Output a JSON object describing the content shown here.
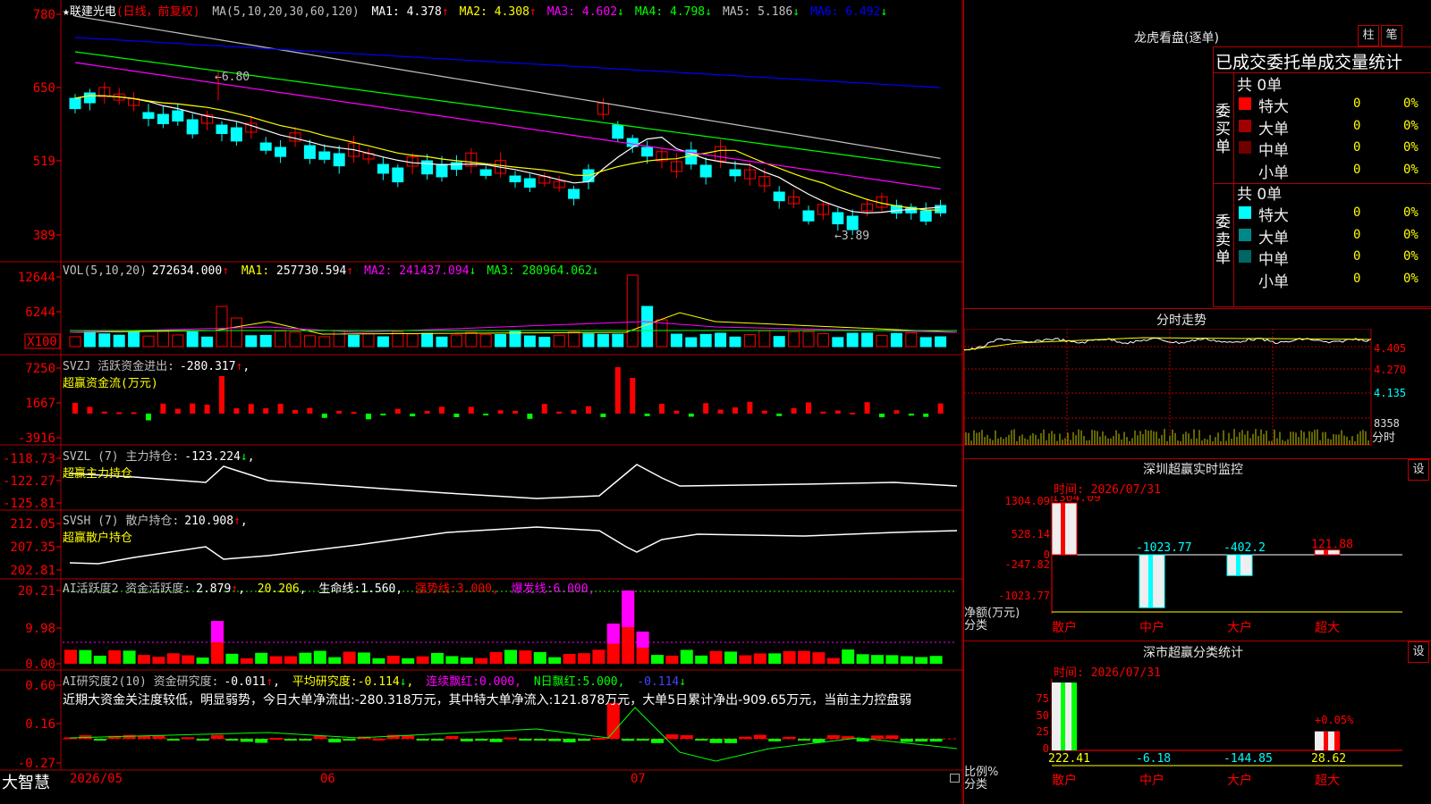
{
  "app_name": "大智慧",
  "stock": {
    "star": "★",
    "name": "联建光电",
    "period": "(日线，前复权)"
  },
  "price_panel": {
    "ma_label": "MA(5,10,20,30,60,120)",
    "ma": [
      {
        "label": "MA1:",
        "value": "4.378",
        "arrow": "↑",
        "color": "#ffffff"
      },
      {
        "label": "MA2:",
        "value": "4.308",
        "arrow": "↑",
        "color": "#ffff00"
      },
      {
        "label": "MA3:",
        "value": "4.602",
        "arrow": "↓",
        "color": "#ff00ff"
      },
      {
        "label": "MA4:",
        "value": "4.798",
        "arrow": "↓",
        "color": "#00ff00"
      },
      {
        "label": "MA5:",
        "value": "5.186",
        "arrow": "↓",
        "color": "#c0c0c0"
      },
      {
        "label": "MA6:",
        "value": "6.492",
        "arrow": "↓",
        "color": "#0000ff"
      }
    ],
    "y_ticks": [
      "780",
      "650",
      "519",
      "389"
    ],
    "high_mark": "6.80",
    "low_mark": "3.89"
  },
  "vol_panel": {
    "label": "VOL(5,10,20)",
    "value": "272634.000",
    "ma": [
      {
        "label": "MA1:",
        "value": "257730.594",
        "arrow": "↑",
        "color": "#ffff00"
      },
      {
        "label": "MA2:",
        "value": "241437.094",
        "arrow": "↓",
        "color": "#ff00ff"
      },
      {
        "label": "MA3:",
        "value": "280964.062",
        "arrow": "↓",
        "color": "#00ff00"
      }
    ],
    "y_ticks": [
      "12644",
      "6244"
    ],
    "unit": "X100"
  },
  "svzj_panel": {
    "label": "SVZJ  活跃资金进出:",
    "value": "-280.317",
    "arrow": "↑",
    "sub": "超赢资金流(万元)",
    "y_ticks": [
      "7250",
      "1667",
      "-3916"
    ]
  },
  "svzl_panel": {
    "label": "SVZL (7) 主力持仓:",
    "value": "-123.224",
    "arrow": "↓",
    "sub": "超赢主力持仓",
    "y_ticks": [
      "-118.73",
      "-122.27",
      "-125.81"
    ]
  },
  "svsh_panel": {
    "label": "SVSH (7) 散户持仓:",
    "value": "210.908",
    "arrow": "↑",
    "sub": "超赢散户持仓",
    "y_ticks": [
      "212.05",
      "207.35",
      "202.81"
    ]
  },
  "ai_active_panel": {
    "label": "AI活跃度2 资金活跃度:",
    "value": "2.879",
    "arrow": "↑",
    "v2": "20.206",
    "l3": "生命线:",
    "v3": "1.560",
    "l4": "强势线:",
    "v4": "3.000",
    "l5": "爆发线:",
    "v5": "6.000",
    "y_ticks": [
      "20.21",
      "9.98",
      "0.00"
    ]
  },
  "ai_research_panel": {
    "label": "AI研究度2(10) 资金研究度:",
    "value": "-0.011",
    "arrow": "↑",
    "l2": "平均研究度:",
    "v2": "-0.114",
    "a2": "↓",
    "l3": "连续飘红:",
    "v3": "0.000",
    "l4": "N日飘红:",
    "v4": "5.000",
    "v5": "-0.114",
    "a5": "↓",
    "comment": "近期大资金关注度较低，明显弱势，今日大单净流出:-280.318万元，其中特大单净流入:121.878万元，大单5日累计净出-909.65万元，当前主力控盘弱",
    "y_ticks": [
      "0.60",
      "0.16",
      "-0.27"
    ]
  },
  "x_axis": [
    "2026/05",
    "06",
    "07"
  ],
  "longhu": {
    "title": "龙虎看盘(逐单)",
    "btn_bar": "柱",
    "btn_pen": "笔",
    "header": "已成交委托单成交量统计",
    "buy": {
      "side": "委买单",
      "total": "共 0单",
      "rows": [
        {
          "name": "特大",
          "count": "0",
          "pct": "0%",
          "color": "#ff0000"
        },
        {
          "name": "大单",
          "count": "0",
          "pct": "0%",
          "color": "#a00000"
        },
        {
          "name": "中单",
          "count": "0",
          "pct": "0%",
          "color": "#700000"
        },
        {
          "name": "小单",
          "count": "0",
          "pct": "0%",
          "color": "#000000"
        }
      ]
    },
    "sell": {
      "side": "委卖单",
      "total": "共 0单",
      "rows": [
        {
          "name": "特大",
          "count": "0",
          "pct": "0%",
          "color": "#00ffff"
        },
        {
          "name": "大单",
          "count": "0",
          "pct": "0%",
          "color": "#008888"
        },
        {
          "name": "中单",
          "count": "0",
          "pct": "0%",
          "color": "#006666"
        },
        {
          "name": "小单",
          "count": "0",
          "pct": "0%",
          "color": "#000000"
        }
      ]
    }
  },
  "fenshi": {
    "title": "分时走势",
    "y_ticks": [
      "4.405",
      "4.270",
      "4.135"
    ],
    "vol_label": "8358",
    "x_label": "分时"
  },
  "monitor": {
    "title": "深圳超赢实时监控",
    "set": "设",
    "time": "时间: 2026/07/31",
    "y_ticks": [
      "1304.09",
      "528.14",
      "0",
      "-247.82",
      "-1023.77"
    ],
    "y_label": "净额(万元)",
    "x_label": "分类",
    "bars": [
      {
        "cat": "散户",
        "value": 1304.09,
        "label": "1304.09"
      },
      {
        "cat": "中户",
        "value": -1023.77,
        "label": "-1023.77"
      },
      {
        "cat": "大户",
        "value": -402.2,
        "label": "-402.2"
      },
      {
        "cat": "超大",
        "value": 121.88,
        "label": "121.88"
      }
    ]
  },
  "classify": {
    "title": "深市超赢分类统计",
    "set": "设",
    "time": "时间: 2026/07/31",
    "y_ticks": [
      "75",
      "50",
      "25",
      "0"
    ],
    "y_label": "比例%",
    "x_label": "分类",
    "bars": [
      {
        "cat": "散户",
        "value": 222.41,
        "pct": 100,
        "label": "222.41"
      },
      {
        "cat": "中户",
        "value": -6.18,
        "pct": 0,
        "label": "-6.18"
      },
      {
        "cat": "大户",
        "value": -144.85,
        "pct": 0,
        "label": "-144.85"
      },
      {
        "cat": "超大",
        "value": 28.62,
        "pct": 28,
        "label": "28.62",
        "pct_label": "+0.05%"
      }
    ]
  },
  "colors": {
    "up": "#ff0000",
    "down": "#00ffff",
    "grid": "#b00000",
    "white_line": "#ffffff",
    "green_bar": "#00ff00"
  }
}
